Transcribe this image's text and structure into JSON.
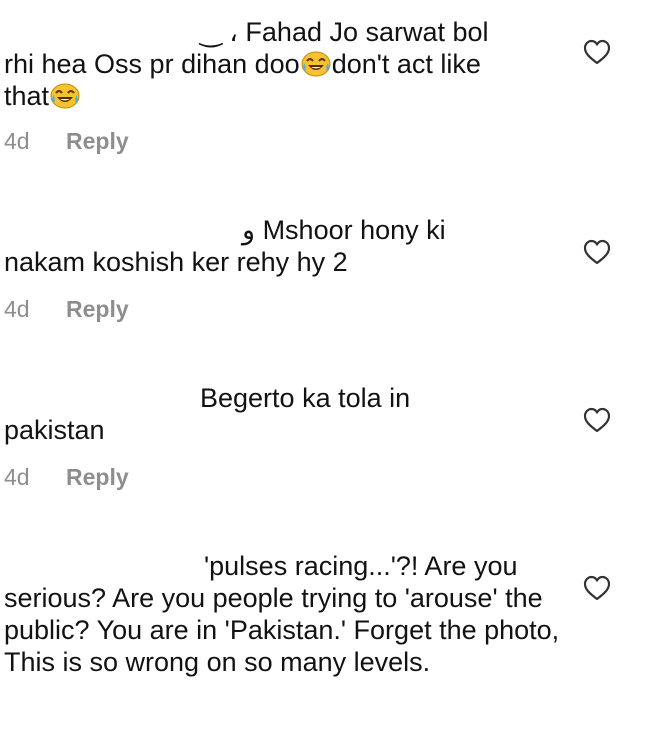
{
  "comments": [
    {
      "user_fragment": "‿ ، ",
      "first_line": "Fahad Jo sarwat bol",
      "line2_a": "rhi hea Oss pr dihan doo",
      "line2_b": "don't act like",
      "line3_a": "that",
      "time": "4d",
      "reply": "Reply"
    },
    {
      "user_fragment": "ﻭ ",
      "first_line": "Mshoor hony ki",
      "rest": "nakam koshish ker rehy hy 2",
      "time": "4d",
      "reply": "Reply"
    },
    {
      "first_line": "Begerto ka tola in",
      "rest": "pakistan",
      "time": "4d",
      "reply": "Reply"
    },
    {
      "first_line": "'pulses racing...'?! Are you",
      "rest": "serious? Are you people trying to 'arouse' the public?  You are in 'Pakistan.' Forget the photo, This is so wrong on so many levels."
    }
  ],
  "icons": {
    "like": "heart-outline-icon",
    "emoji": "face-with-tears-of-joy-icon"
  },
  "colors": {
    "text": "#121212",
    "meta": "#8e8e8e",
    "emoji_face": "#f5c232"
  }
}
